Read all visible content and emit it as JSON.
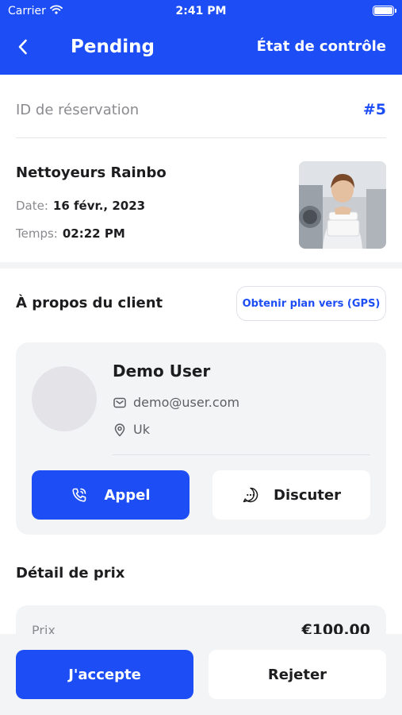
{
  "status_bar": {
    "carrier": "Carrier",
    "time": "2:41 PM"
  },
  "nav": {
    "back_icon": "chevron-left-icon",
    "title": "Pending",
    "action_label": "État de contrôle"
  },
  "booking": {
    "label": "ID de réservation",
    "id": "#5"
  },
  "service": {
    "name": "Nettoyeurs Rainbo",
    "date_label": "Date:",
    "date_value": "16 févr., 2023",
    "time_label": "Temps:",
    "time_value": "02:22 PM"
  },
  "client_section": {
    "title": "À propos du client",
    "gps_button": "Obtenir plan vers (GPS)"
  },
  "client": {
    "name": "Demo User",
    "email": "demo@user.com",
    "location": "Uk",
    "call_label": "Appel",
    "chat_label": "Discuter"
  },
  "price": {
    "title": "Détail de prix",
    "label": "Prix",
    "value": "€100.00"
  },
  "actions": {
    "accept_label": "J'accepte",
    "reject_label": "Rejeter"
  },
  "colors": {
    "primary": "#1d4ef5",
    "card_bg": "#f3f4f6",
    "muted_text": "#8a8a8f"
  }
}
